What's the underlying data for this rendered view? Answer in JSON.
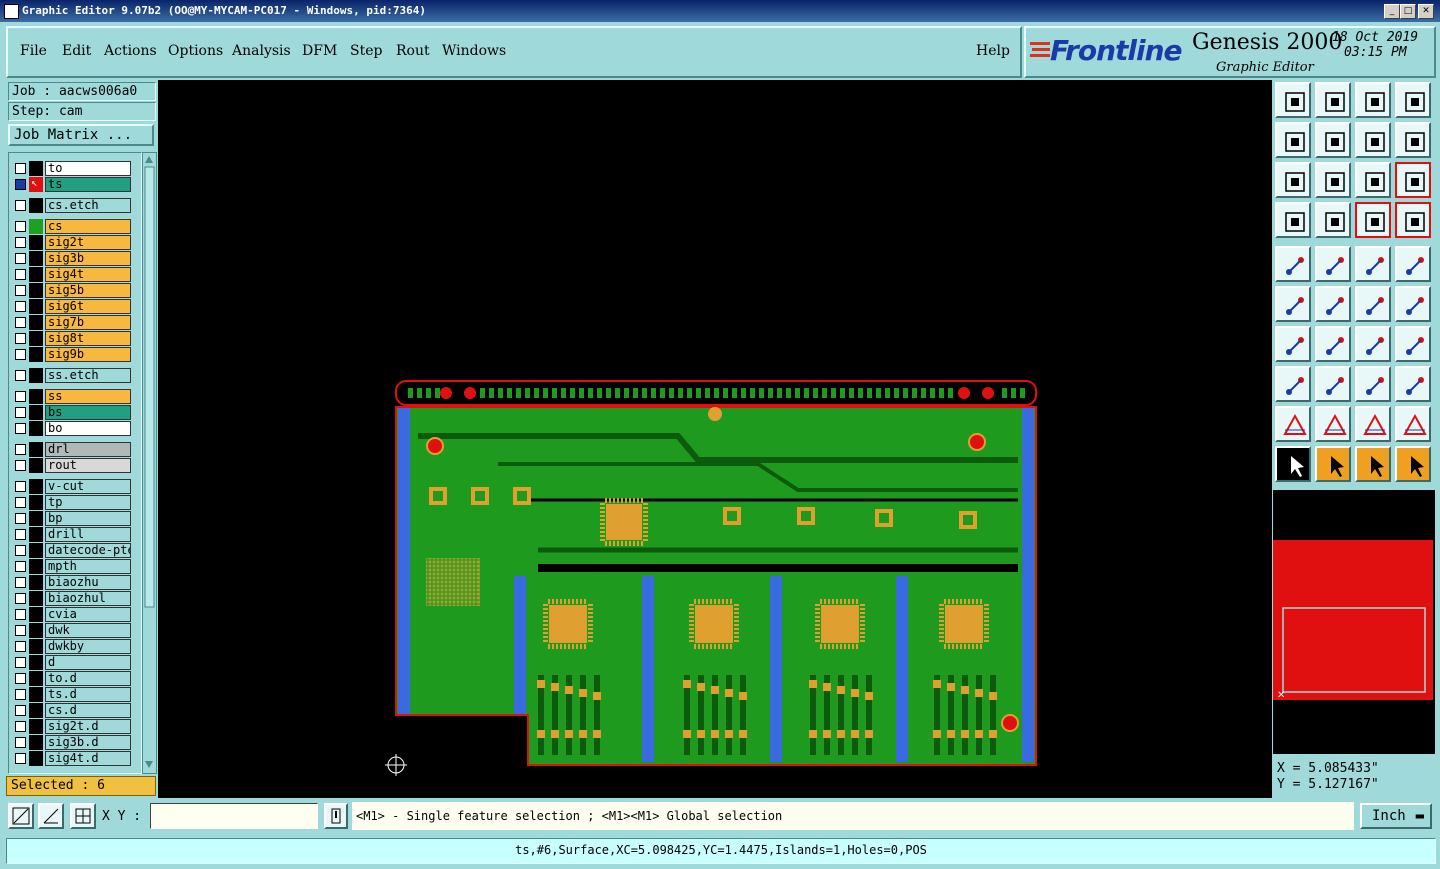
{
  "window": {
    "title": "Graphic Editor 9.07b2 (OO@MY-MYCAM-PC017 - Windows, pid:7364)"
  },
  "menu": {
    "items": [
      "File",
      "Edit",
      "Actions",
      "Options",
      "Analysis",
      "DFM",
      "Step",
      "Rout",
      "Windows"
    ],
    "help": "Help"
  },
  "brand": {
    "logo": "Frontline",
    "product": "Genesis 2000",
    "subtitle": "Graphic Editor",
    "date": "18 Oct 2019",
    "time": "03:15 PM"
  },
  "job": {
    "job_label": "Job : aacws006a0",
    "step_label": "Step: cam",
    "matrix_button": "Job Matrix ..."
  },
  "layers": [
    {
      "name": "to",
      "color": "#ffffff",
      "swatch": "#000000"
    },
    {
      "name": "ts",
      "color": "#20a080",
      "swatch": "#000000",
      "active": true
    },
    {
      "name": "cs.etch",
      "color": "#9fd9d9",
      "swatch": "#000000"
    },
    {
      "name": "cs",
      "color": "#f8b840",
      "swatch": "#20a020"
    },
    {
      "name": "sig2t",
      "color": "#f8b840",
      "swatch": "#000000"
    },
    {
      "name": "sig3b",
      "color": "#f8b840",
      "swatch": "#000000"
    },
    {
      "name": "sig4t",
      "color": "#f8b840",
      "swatch": "#000000"
    },
    {
      "name": "sig5b",
      "color": "#f8b840",
      "swatch": "#000000"
    },
    {
      "name": "sig6t",
      "color": "#f8b840",
      "swatch": "#000000"
    },
    {
      "name": "sig7b",
      "color": "#f8b840",
      "swatch": "#000000"
    },
    {
      "name": "sig8t",
      "color": "#f8b840",
      "swatch": "#000000"
    },
    {
      "name": "sig9b",
      "color": "#f8b840",
      "swatch": "#000000"
    },
    {
      "name": "ss.etch",
      "color": "#9fd9d9",
      "swatch": "#000000"
    },
    {
      "name": "ss",
      "color": "#f8b840",
      "swatch": "#000000"
    },
    {
      "name": "bs",
      "color": "#20a080",
      "swatch": "#000000"
    },
    {
      "name": "bo",
      "color": "#ffffff",
      "swatch": "#000000"
    },
    {
      "name": "drl",
      "color": "#b0b8b8",
      "swatch": "#000000"
    },
    {
      "name": "rout",
      "color": "#d8d8d8",
      "swatch": "#000000"
    },
    {
      "name": "v-cut",
      "color": "#9fd9d9",
      "swatch": "#000000"
    },
    {
      "name": "tp",
      "color": "#9fd9d9",
      "swatch": "#000000"
    },
    {
      "name": "bp",
      "color": "#9fd9d9",
      "swatch": "#000000"
    },
    {
      "name": "drill",
      "color": "#9fd9d9",
      "swatch": "#000000"
    },
    {
      "name": "datecode-pte",
      "color": "#9fd9d9",
      "swatch": "#000000"
    },
    {
      "name": "mpth",
      "color": "#9fd9d9",
      "swatch": "#000000"
    },
    {
      "name": "biaozhu",
      "color": "#9fd9d9",
      "swatch": "#000000"
    },
    {
      "name": "biaozhul",
      "color": "#9fd9d9",
      "swatch": "#000000"
    },
    {
      "name": "cvia",
      "color": "#9fd9d9",
      "swatch": "#000000"
    },
    {
      "name": "dwk",
      "color": "#9fd9d9",
      "swatch": "#000000"
    },
    {
      "name": "dwkby",
      "color": "#9fd9d9",
      "swatch": "#000000"
    },
    {
      "name": "d",
      "color": "#9fd9d9",
      "swatch": "#000000"
    },
    {
      "name": "to.d",
      "color": "#9fd9d9",
      "swatch": "#000000"
    },
    {
      "name": "ts.d",
      "color": "#9fd9d9",
      "swatch": "#000000"
    },
    {
      "name": "cs.d",
      "color": "#9fd9d9",
      "swatch": "#000000"
    },
    {
      "name": "sig2t.d",
      "color": "#9fd9d9",
      "swatch": "#000000"
    },
    {
      "name": "sig3b.d",
      "color": "#9fd9d9",
      "swatch": "#000000"
    },
    {
      "name": "sig4t.d",
      "color": "#9fd9d9",
      "swatch": "#000000"
    }
  ],
  "selected": "Selected : 6",
  "coords": {
    "x": "X = 5.085433\"",
    "y": "Y = 5.127167\""
  },
  "bottom": {
    "xy_label": "X Y :",
    "xy_value": "",
    "message": "<M1> - Single feature selection ; <M1><M1> Global selection",
    "unit": "Inch"
  },
  "status": "ts,#6,Surface,XC=5.098425,YC=1.4475,Islands=1,Holes=0,POS",
  "colors": {
    "board_green": "#1e9a1e",
    "copper": "#e0a030",
    "blue_rail": "#3a6ae0",
    "red_pad": "#e01010",
    "accent_cyan": "#9fd9d9"
  }
}
